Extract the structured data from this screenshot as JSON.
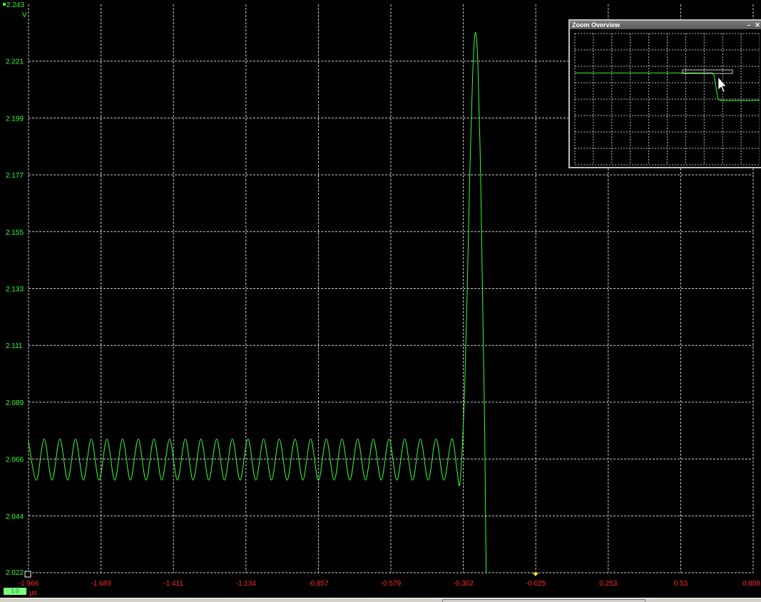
{
  "app": {
    "zoom_overview_title": "Zoom Overview",
    "minimize_glyph": "–",
    "close_glyph": "✕"
  },
  "axes": {
    "y_unit": "V",
    "x_unit": "μs",
    "y_ticks": [
      "2.243",
      "2.221",
      "2.199",
      "2.177",
      "2.155",
      "2.133",
      "2.111",
      "2.089",
      "2.066",
      "2.044",
      "2.022"
    ],
    "x_ticks": [
      "-1.966",
      "-1.689",
      "-1.411",
      "-1.134",
      "-0.857",
      "-0.579",
      "-0.302",
      "-0.025",
      "0.253",
      "0.53",
      "0.808"
    ]
  },
  "channel": {
    "badge": "1.0",
    "color": "#33ff33"
  },
  "colors": {
    "grid": "#cfcfcf",
    "x_labels": "#ff2a2a",
    "y_labels": "#33ff33",
    "trace": "#33ff33",
    "trigger_marker": "#ffee00"
  },
  "chart_data": {
    "type": "line",
    "x_range": [
      -1.966,
      0.808
    ],
    "y_range": [
      2.022,
      2.243
    ],
    "grid": true,
    "series": [
      {
        "color": "#33ff33",
        "points": [
          [
            -1.966,
            2.073
          ],
          [
            -1.936,
            2.058
          ],
          [
            -1.906,
            2.074
          ],
          [
            -1.876,
            2.058
          ],
          [
            -1.846,
            2.074
          ],
          [
            -1.816,
            2.058
          ],
          [
            -1.786,
            2.074
          ],
          [
            -1.756,
            2.058
          ],
          [
            -1.726,
            2.074
          ],
          [
            -1.696,
            2.058
          ],
          [
            -1.666,
            2.074
          ],
          [
            -1.636,
            2.058
          ],
          [
            -1.606,
            2.074
          ],
          [
            -1.576,
            2.058
          ],
          [
            -1.546,
            2.074
          ],
          [
            -1.516,
            2.058
          ],
          [
            -1.486,
            2.074
          ],
          [
            -1.456,
            2.058
          ],
          [
            -1.426,
            2.074
          ],
          [
            -1.396,
            2.058
          ],
          [
            -1.366,
            2.074
          ],
          [
            -1.336,
            2.058
          ],
          [
            -1.306,
            2.074
          ],
          [
            -1.276,
            2.058
          ],
          [
            -1.246,
            2.074
          ],
          [
            -1.216,
            2.058
          ],
          [
            -1.186,
            2.074
          ],
          [
            -1.156,
            2.058
          ],
          [
            -1.126,
            2.074
          ],
          [
            -1.096,
            2.058
          ],
          [
            -1.066,
            2.074
          ],
          [
            -1.036,
            2.058
          ],
          [
            -1.006,
            2.074
          ],
          [
            -0.976,
            2.058
          ],
          [
            -0.946,
            2.074
          ],
          [
            -0.916,
            2.058
          ],
          [
            -0.886,
            2.074
          ],
          [
            -0.856,
            2.058
          ],
          [
            -0.826,
            2.074
          ],
          [
            -0.796,
            2.058
          ],
          [
            -0.766,
            2.074
          ],
          [
            -0.736,
            2.058
          ],
          [
            -0.706,
            2.074
          ],
          [
            -0.676,
            2.058
          ],
          [
            -0.646,
            2.074
          ],
          [
            -0.616,
            2.058
          ],
          [
            -0.586,
            2.074
          ],
          [
            -0.556,
            2.058
          ],
          [
            -0.526,
            2.074
          ],
          [
            -0.496,
            2.058
          ],
          [
            -0.466,
            2.074
          ],
          [
            -0.436,
            2.058
          ],
          [
            -0.406,
            2.074
          ],
          [
            -0.376,
            2.058
          ],
          [
            -0.346,
            2.074
          ],
          [
            -0.326,
            2.062
          ],
          [
            -0.316,
            2.056
          ],
          [
            -0.306,
            2.07
          ],
          [
            -0.296,
            2.095
          ],
          [
            -0.286,
            2.135
          ],
          [
            -0.276,
            2.18
          ],
          [
            -0.266,
            2.215
          ],
          [
            -0.256,
            2.232
          ],
          [
            -0.246,
            2.22
          ],
          [
            -0.236,
            2.18
          ],
          [
            -0.228,
            2.13
          ],
          [
            -0.22,
            2.08
          ],
          [
            -0.216,
            2.04
          ],
          [
            -0.214,
            2.022
          ]
        ]
      }
    ],
    "trigger_marker_x": -0.025,
    "overview": {
      "points": [
        [
          0.0,
          0.3
        ],
        [
          0.745,
          0.3
        ],
        [
          0.755,
          0.32
        ],
        [
          0.765,
          0.42
        ],
        [
          0.775,
          0.5
        ],
        [
          0.79,
          0.51
        ],
        [
          1.0,
          0.51
        ]
      ]
    }
  }
}
